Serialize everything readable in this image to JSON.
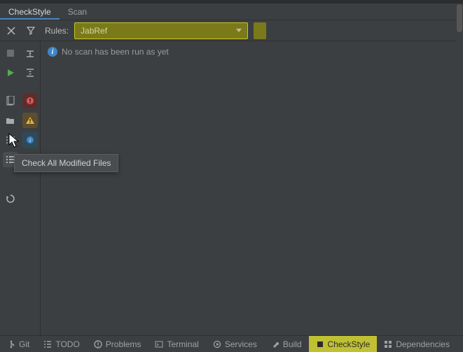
{
  "tabs": {
    "checkstyle": "CheckStyle",
    "scan": "Scan"
  },
  "toolbar": {
    "rules_label": "Rules:",
    "dropdown_value": "JabRef"
  },
  "content": {
    "message": "No scan has been run as yet"
  },
  "tooltip": {
    "text": "Check All Modified Files"
  },
  "status_bar": {
    "git": "Git",
    "todo": "TODO",
    "problems": "Problems",
    "terminal": "Terminal",
    "services": "Services",
    "build": "Build",
    "checkstyle": "CheckStyle",
    "dependencies": "Dependencies"
  },
  "icons": {
    "close": "close-icon",
    "filter": "filter-icon",
    "stop": "stop-icon",
    "collapse": "collapse-icon",
    "run": "run-icon",
    "expand2": "expand-icon",
    "doc": "doc-icon",
    "error": "error-icon",
    "folder": "folder-icon",
    "warning": "warning-icon",
    "list": "list-icon",
    "info_badge": "info-icon",
    "check_modified": "check-modified-icon",
    "refresh": "refresh-icon",
    "info_circle": "info-icon"
  }
}
